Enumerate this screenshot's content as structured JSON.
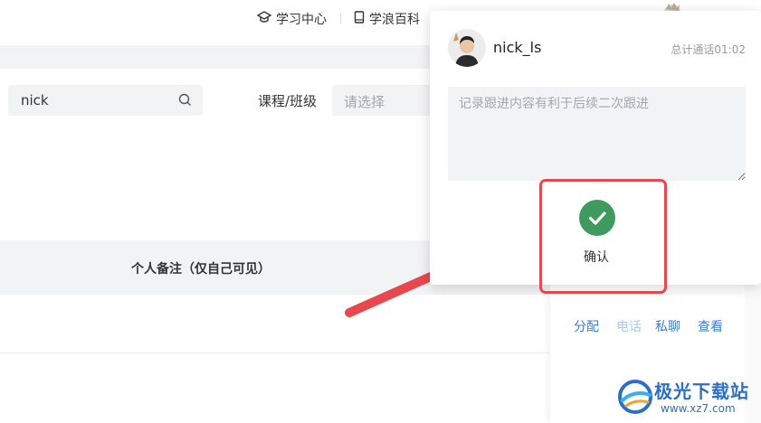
{
  "top_nav": {
    "study_center": "学习中心",
    "wiki": "学浪百科"
  },
  "search": {
    "value": "nick"
  },
  "filter": {
    "label": "课程/班级",
    "placeholder": "请选择"
  },
  "table": {
    "note_column_header": "个人备注（仅自己可见）"
  },
  "row_actions": [
    {
      "label": "分配",
      "enabled": true
    },
    {
      "label": "电话",
      "enabled": false
    },
    {
      "label": "私聊",
      "enabled": true
    },
    {
      "label": "查看",
      "enabled": true
    }
  ],
  "call_popup": {
    "username": "nick_ls",
    "call_duration_text": "总计通话01:02",
    "note_placeholder": "记录跟进内容有利于后续二次跟进",
    "confirm_label": "确认"
  },
  "watermark": {
    "brand": "极光下载站",
    "url": "www.xz7.com"
  },
  "colors": {
    "accent_link": "#3a7bd5",
    "confirm_green": "#3f9a5f",
    "highlight_red": "#e8484d",
    "panel_gray": "#f2f3f5"
  }
}
